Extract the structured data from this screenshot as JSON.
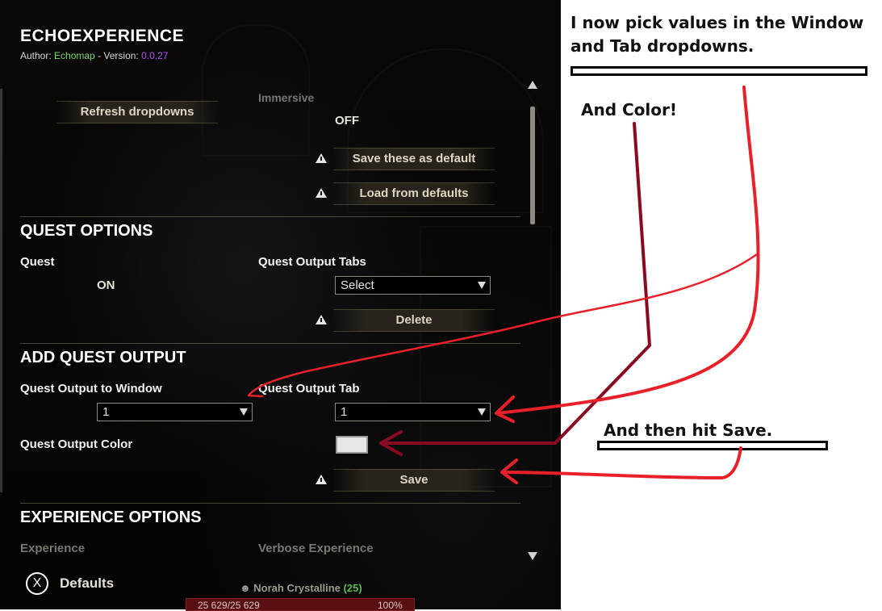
{
  "addon": {
    "title": "ECHOEXPERIENCE",
    "author_prefix": "Author: ",
    "author": "Echomap",
    "version_prefix": " - Version: ",
    "version": "0.0.27"
  },
  "top_controls": {
    "refresh_label": "Refresh dropdowns",
    "immersive_label": "Immersive",
    "immersive_value": "OFF",
    "save_default_label": "Save these as default",
    "load_defaults_label": "Load from defaults"
  },
  "quest_options": {
    "header": "QUEST OPTIONS",
    "quest_label": "Quest",
    "quest_value": "ON",
    "tabs_label": "Quest Output Tabs",
    "tabs_value": "Select",
    "delete_label": "Delete"
  },
  "add_quest_output": {
    "header": "ADD QUEST OUTPUT",
    "window_label": "Quest Output to Window",
    "window_value": "1",
    "tab_label": "Quest Output Tab",
    "tab_value": "1",
    "color_label": "Quest Output Color",
    "color_value": "#e6e6e6",
    "save_label": "Save"
  },
  "experience_options": {
    "header": "EXPERIENCE OPTIONS",
    "experience_label": "Experience",
    "verbose_label": "Verbose Experience"
  },
  "footer": {
    "key": "X",
    "defaults_label": "Defaults",
    "character_name": "Norah Crystalline",
    "character_level": "(25)",
    "health_text": "25 629/25 629",
    "health_percent": "100%"
  },
  "annotations": {
    "note1_line1": "I now pick values in the Window",
    "note1_line2": "and Tab dropdowns.",
    "note2": "And Color!",
    "note3": "And then hit Save."
  },
  "colors": {
    "arrow_red": "#e8202a",
    "arrow_dark": "#8a0a22",
    "author_green": "#77d86a",
    "version_purple": "#b050ff"
  }
}
